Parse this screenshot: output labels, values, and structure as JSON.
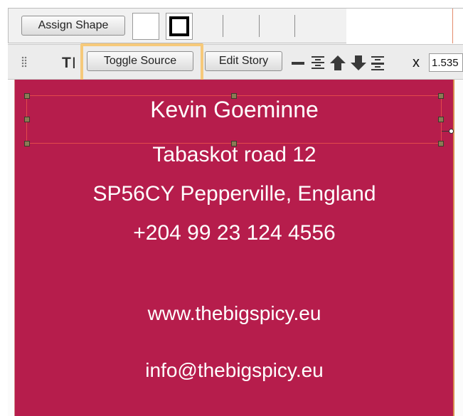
{
  "toolbar_top": {
    "assign_shape_label": "Assign Shape",
    "fill_swatch_color": "#ffffff",
    "stroke_swatch_color": "#000000"
  },
  "toolbar_text": {
    "text_tool_glyph": "T",
    "toggle_source_label": "Toggle Source",
    "edit_story_label": "Edit Story",
    "x_label": "x",
    "x_value": "1.535"
  },
  "card": {
    "background_color": "#b61d4c",
    "name": "Kevin Goeminne",
    "address_line1": "Tabaskot road 12",
    "address_line2": "SP56CY Pepperville, England",
    "phone": "+204 99 23 124 4556",
    "website": "www.thebigspicy.eu",
    "email": "info@thebigspicy.eu"
  },
  "highlight_color": "#f6c97a"
}
